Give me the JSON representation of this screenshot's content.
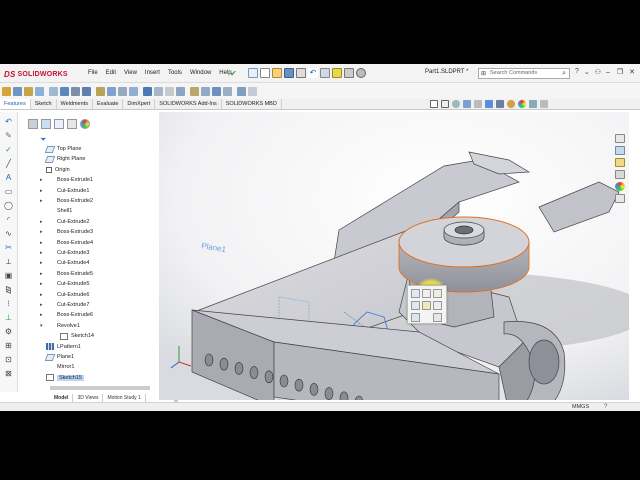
{
  "app": {
    "brand": "SOLIDWORKS",
    "brand_mark": "DS",
    "document_title": "Part1.SLDPRT *",
    "menus": [
      "File",
      "Edit",
      "View",
      "Insert",
      "Tools",
      "Window",
      "Help"
    ]
  },
  "search": {
    "placeholder": "Search Commands"
  },
  "command_tabs": [
    "Features",
    "Sketch",
    "Weldments",
    "Evaluate",
    "DimXpert",
    "SOLIDWORKS Add-Ins",
    "SOLIDWORKS MBD"
  ],
  "active_command_tab": "Features",
  "feature_tree": [
    {
      "label": "Top Plane",
      "type": "plane",
      "expandable": false
    },
    {
      "label": "Right Plane",
      "type": "plane",
      "expandable": false
    },
    {
      "label": "Origin",
      "type": "origin",
      "expandable": false
    },
    {
      "label": "Boss-Extrude1",
      "type": "feature",
      "expandable": true
    },
    {
      "label": "Cut-Extrude1",
      "type": "feature",
      "expandable": true
    },
    {
      "label": "Boss-Extrude2",
      "type": "feature",
      "expandable": true
    },
    {
      "label": "Shell1",
      "type": "feature",
      "expandable": false
    },
    {
      "label": "Cut-Extrude2",
      "type": "feature",
      "expandable": true
    },
    {
      "label": "Boss-Extrude3",
      "type": "feature",
      "expandable": true
    },
    {
      "label": "Boss-Extrude4",
      "type": "feature",
      "expandable": true
    },
    {
      "label": "Cut-Extrude3",
      "type": "feature",
      "expandable": true
    },
    {
      "label": "Cut-Extrude4",
      "type": "feature",
      "expandable": true
    },
    {
      "label": "Boss-Extrude5",
      "type": "feature",
      "expandable": true
    },
    {
      "label": "Cut-Extrude5",
      "type": "feature",
      "expandable": true
    },
    {
      "label": "Cut-Extrude6",
      "type": "feature",
      "expandable": true
    },
    {
      "label": "Cut-Extrude7",
      "type": "feature",
      "expandable": true
    },
    {
      "label": "Boss-Extrude6",
      "type": "feature",
      "expandable": true
    },
    {
      "label": "Revolve1",
      "type": "feature",
      "expandable": true,
      "expanded": true
    },
    {
      "label": "Sketch14",
      "type": "sketch",
      "expandable": false,
      "child": true
    },
    {
      "label": "LPattern1",
      "type": "pattern",
      "expandable": false
    },
    {
      "label": "Plane1",
      "type": "plane",
      "expandable": false
    },
    {
      "label": "Mirror1",
      "type": "feature",
      "expandable": false
    },
    {
      "label": "Sketch15",
      "type": "sketch",
      "expandable": false,
      "selected": true
    }
  ],
  "bottom_tabs": [
    "Model",
    "3D Views",
    "Motion Study 1"
  ],
  "active_bottom_tab": "Model",
  "viewport": {
    "plane_label": "Plane1"
  },
  "status": {
    "units": "MMGS",
    "help_glyph": "?"
  },
  "colors": {
    "brand": "#c8102e",
    "accent": "#1f5fbf",
    "selection_edge": "#e07020",
    "cursor_highlight": "#f5ea3c",
    "plane_label": "#6a9fe0"
  },
  "icons": {
    "search": "search-icon",
    "pin": "pin-icon",
    "filter": "filter-icon",
    "help": "help-icon"
  }
}
